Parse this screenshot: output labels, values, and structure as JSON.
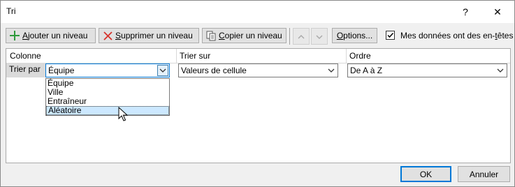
{
  "window": {
    "title": "Tri",
    "help": "?",
    "close": "✕"
  },
  "toolbar": {
    "add_pre": "",
    "add_key": "A",
    "add_post": "jouter un niveau",
    "del_pre": "",
    "del_key": "S",
    "del_post": "upprimer un niveau",
    "copy_pre": "",
    "copy_key": "C",
    "copy_post": "opier un niveau",
    "options_pre": "",
    "options_key": "O",
    "options_post": "ptions...",
    "up_icon": "chevron-up-icon",
    "down_icon": "chevron-down-icon"
  },
  "headers_checkbox": {
    "checked": true,
    "label_pre": "Mes données ont des en-",
    "label_key": "t",
    "label_post": "êtes"
  },
  "grid": {
    "col_headers": [
      "Colonne",
      "Trier sur",
      "Ordre"
    ],
    "row": {
      "label": "Trier par",
      "column_value": "Équipe",
      "sort_on_value": "Valeurs de cellule",
      "order_value": "De A à Z"
    },
    "dropdown_options": [
      "Équipe",
      "Ville",
      "Entraîneur",
      "Aléatoire"
    ],
    "dropdown_selected_index": 3
  },
  "footer": {
    "ok_label": "OK",
    "cancel_label": "Annuler"
  },
  "colors": {
    "accent": "#0078d7",
    "selection": "#cce8ff",
    "add_icon": "#2e9a3c",
    "delete_icon": "#d6332b"
  }
}
